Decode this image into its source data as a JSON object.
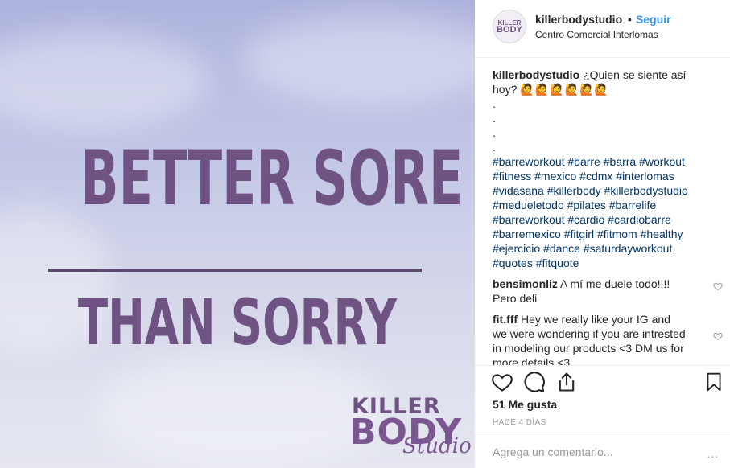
{
  "image": {
    "line1": "Better Sore",
    "line2": "Than Sorry",
    "logo": {
      "word1": "Killer",
      "word2": "Body",
      "word3": "Studio"
    }
  },
  "header": {
    "avatar_text_top": "KILLER",
    "avatar_text_bottom": "BODY",
    "username": "killerbodystudio",
    "separator": "•",
    "follow": "Seguir",
    "location": "Centro Comercial Interlomas"
  },
  "caption": {
    "username": "killerbodystudio",
    "text": "¿Quien se siente así hoy?",
    "emojis": "🙋🙋🙋🙋🙋🙋",
    "dots": [
      ".",
      ".",
      ".",
      "."
    ],
    "hashtags": "#barreworkout #barre #barra #workout #fitness #mexico #cdmx #interlomas #vidasana #killerbody #killerbodystudio #medueletodo #pilates #barrelife #barreworkout #cardio #cardiobarre #barremexico #fitgirl #fitmom #healthy #ejercicio #dance #saturdayworkout #quotes #fitquote"
  },
  "comments": [
    {
      "username": "bensimonliz",
      "text": "A mí me duele todo!!!! Pero deli"
    },
    {
      "username": "fit.fff",
      "text": "Hey we really like your IG and we were wondering if you are intrested in modeling our products <3 DM us for more details <3"
    }
  ],
  "likes": "51 Me gusta",
  "time_ago": "HACE 4 DÍAS",
  "add_comment": {
    "placeholder": "Agrega un comentario...",
    "more": "..."
  },
  "colors": {
    "accent": "#3897f0",
    "hashtag": "#003569",
    "sign": "#6e5383"
  }
}
